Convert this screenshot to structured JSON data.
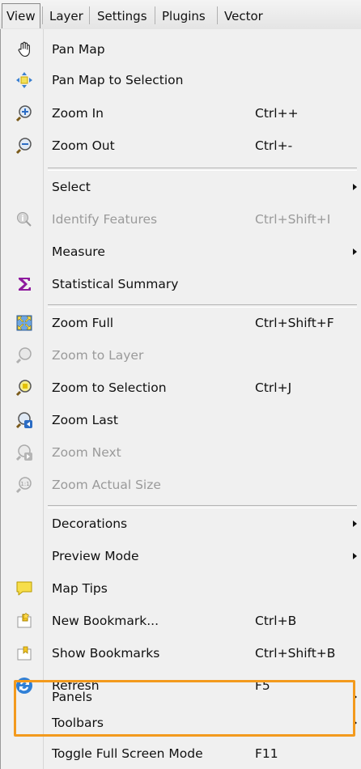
{
  "menubar": {
    "items": [
      "View",
      "Layer",
      "Settings",
      "Plugins",
      "Vector"
    ]
  },
  "menu": {
    "items": [
      {
        "label": "Pan Map",
        "icon": "pan-hand-icon"
      },
      {
        "label": "Pan Map to Selection",
        "icon": "pan-selection-icon"
      },
      {
        "label": "Zoom In",
        "shortcut": "Ctrl++",
        "icon": "zoom-in-icon"
      },
      {
        "label": "Zoom Out",
        "shortcut": "Ctrl+-",
        "icon": "zoom-out-icon"
      },
      {
        "label": "Select",
        "submenu": true
      },
      {
        "label": "Identify Features",
        "shortcut": "Ctrl+Shift+I",
        "icon": "identify-icon",
        "disabled": true
      },
      {
        "label": "Measure",
        "submenu": true
      },
      {
        "label": "Statistical Summary",
        "icon": "sigma-icon"
      },
      {
        "label": "Zoom Full",
        "shortcut": "Ctrl+Shift+F",
        "icon": "zoom-full-icon"
      },
      {
        "label": "Zoom to Layer",
        "icon": "zoom-layer-icon",
        "disabled": true
      },
      {
        "label": "Zoom to Selection",
        "shortcut": "Ctrl+J",
        "icon": "zoom-selection-icon"
      },
      {
        "label": "Zoom Last",
        "icon": "zoom-last-icon"
      },
      {
        "label": "Zoom Next",
        "icon": "zoom-next-icon",
        "disabled": true
      },
      {
        "label": "Zoom Actual Size",
        "icon": "zoom-actual-icon",
        "disabled": true
      },
      {
        "label": "Decorations",
        "submenu": true
      },
      {
        "label": "Preview Mode",
        "submenu": true
      },
      {
        "label": "Map Tips",
        "icon": "map-tips-icon"
      },
      {
        "label": "New Bookmark...",
        "shortcut": "Ctrl+B",
        "icon": "new-bookmark-icon"
      },
      {
        "label": "Show Bookmarks",
        "shortcut": "Ctrl+Shift+B",
        "icon": "show-bookmarks-icon"
      },
      {
        "label": "Refresh",
        "shortcut": "F5",
        "icon": "refresh-icon"
      },
      {
        "label": "Panels",
        "submenu": true
      },
      {
        "label": "Toolbars",
        "submenu": true
      },
      {
        "label": "Toggle Full Screen Mode",
        "shortcut": "F11"
      }
    ]
  },
  "colors": {
    "highlight_border": "#f39a1d",
    "sigma": "#8e1a9e",
    "disabled_text": "#9a9a9a"
  }
}
